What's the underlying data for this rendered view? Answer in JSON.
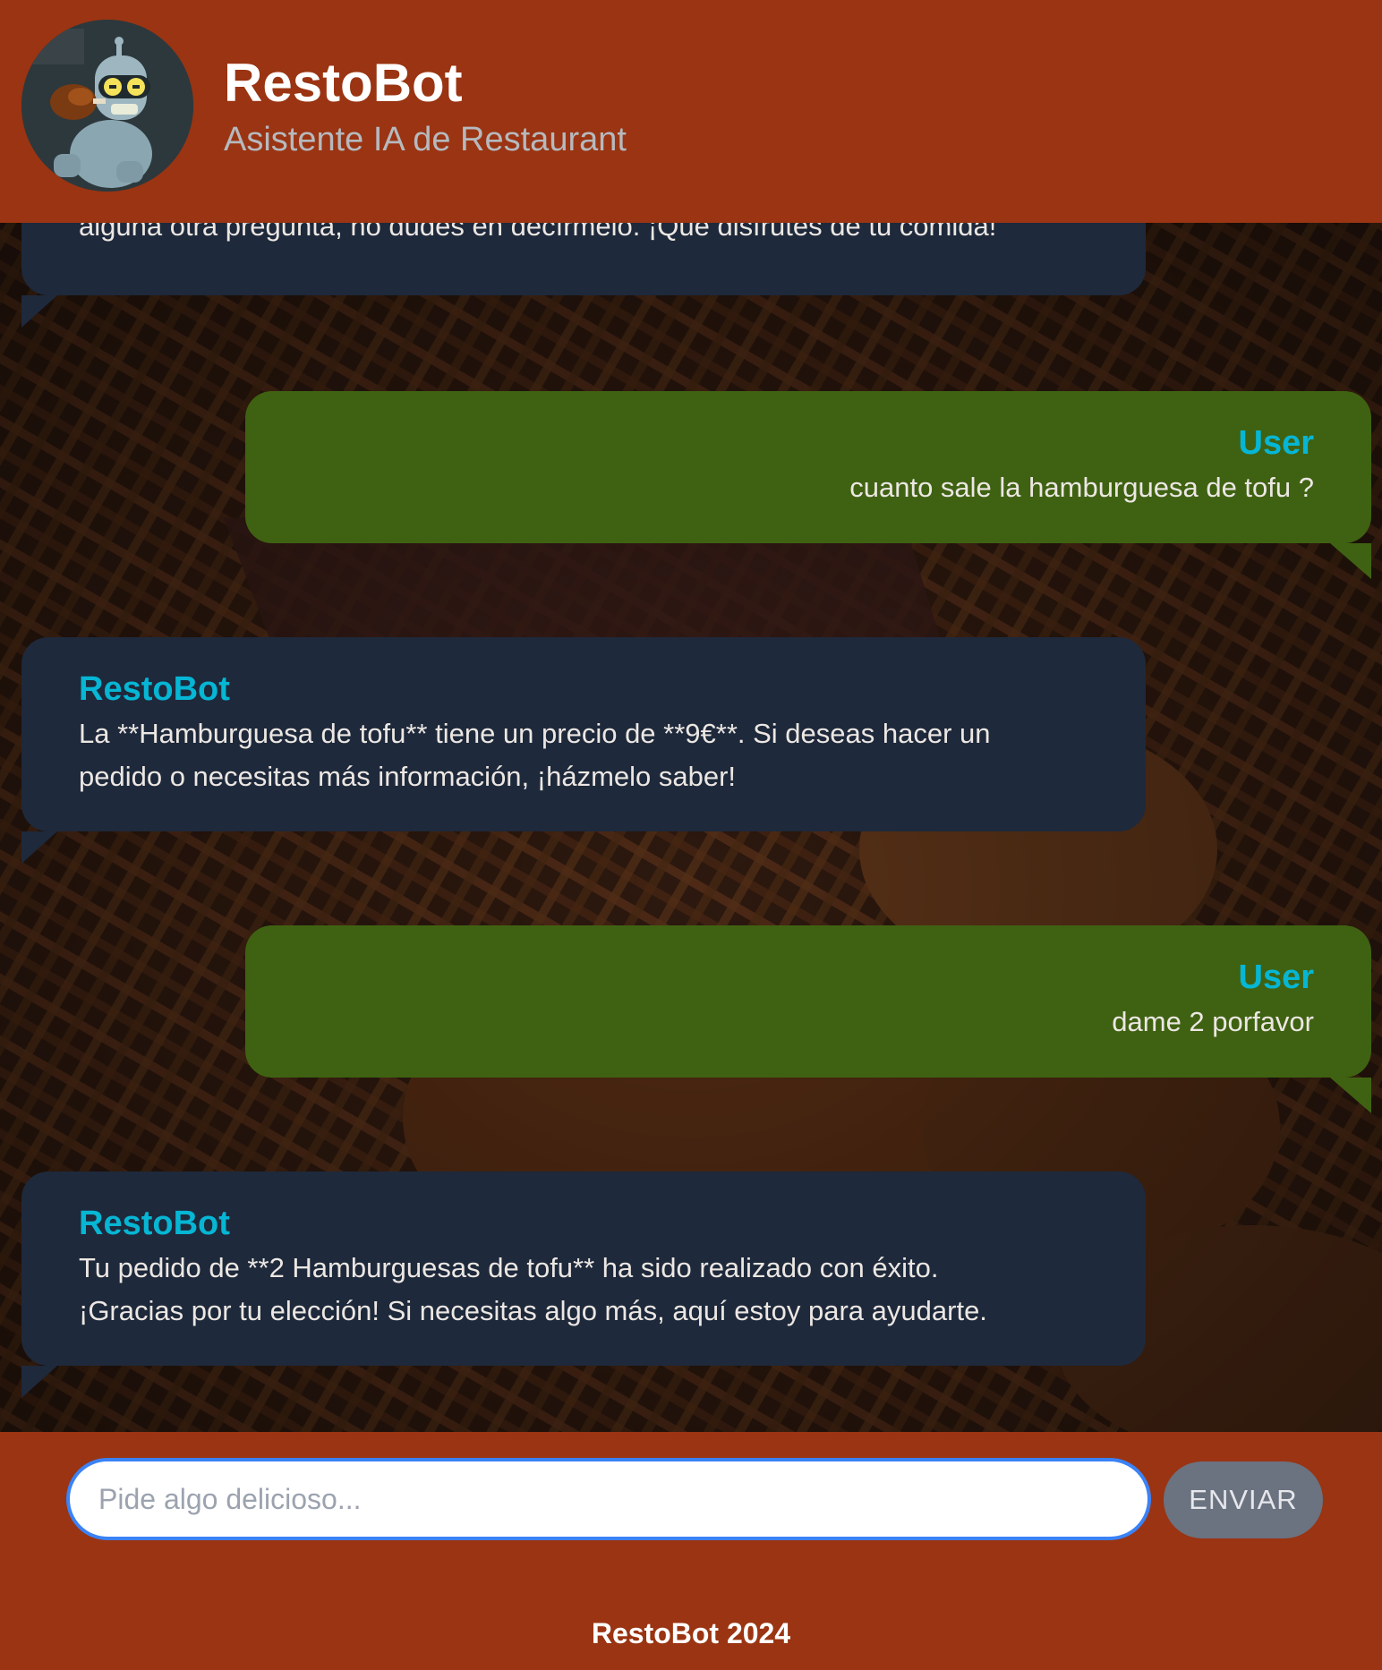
{
  "header": {
    "title": "RestoBot",
    "subtitle": "Asistente IA de Restaurant",
    "avatar_icon": "robot-avatar"
  },
  "messages": [
    {
      "role": "bot",
      "sender": "",
      "lines": [
        "alguna otra pregunta, no dudes en decírmelo. ¡Que disfrutes de tu comida!"
      ]
    },
    {
      "role": "user",
      "sender": "User",
      "lines": [
        "cuanto sale la hamburguesa de tofu ?"
      ]
    },
    {
      "role": "bot",
      "sender": "RestoBot",
      "lines": [
        "La **Hamburguesa de tofu** tiene un precio de **9€**. Si deseas hacer un",
        "pedido o necesitas más información, ¡házmelo saber!"
      ]
    },
    {
      "role": "user",
      "sender": "User",
      "lines": [
        "dame 2 porfavor"
      ]
    },
    {
      "role": "bot",
      "sender": "RestoBot",
      "lines": [
        "Tu pedido de **2 Hamburguesas de tofu** ha sido realizado con éxito.",
        "¡Gracias por tu elección! Si necesitas algo más, aquí estoy para ayudarte."
      ]
    }
  ],
  "composer": {
    "placeholder": "Pide algo delicioso...",
    "value": "",
    "send_label": "ENVIAR"
  },
  "footer": {
    "text": "RestoBot 2024"
  },
  "colors": {
    "brand": "#9a3412",
    "bot_bubble": "#1e293b",
    "user_bubble": "#3f6212",
    "sender_name": "#06b6d4",
    "input_focus": "#3b82f6",
    "send_button": "#6b7280"
  }
}
